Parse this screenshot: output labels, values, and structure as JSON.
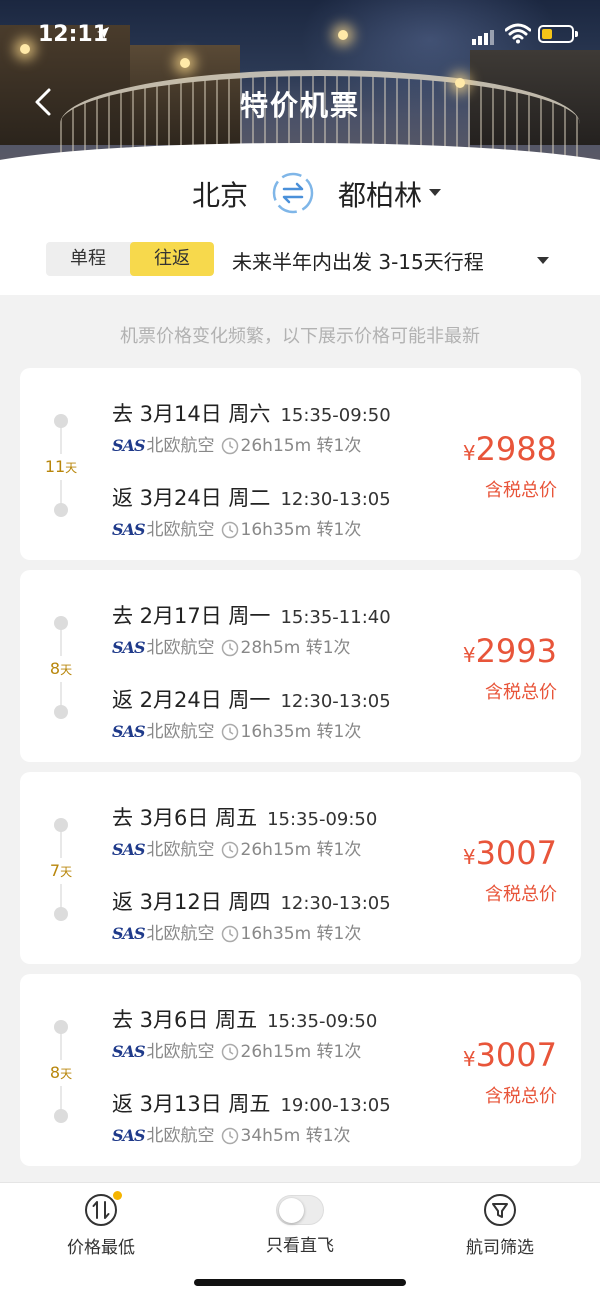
{
  "status_bar": {
    "time": "12:11"
  },
  "header": {
    "title": "特价机票"
  },
  "route": {
    "from": "北京",
    "to": "都柏林",
    "trip_types": [
      "单程",
      "往返"
    ],
    "selected_trip_type": "往返",
    "date_range": "未来半年内出发 3-15天行程"
  },
  "notice": "机票价格变化频繁，以下展示价格可能非最新",
  "flights": [
    {
      "days": "11",
      "days_unit": "天",
      "out": {
        "date": "去 3月14日 周六",
        "times": "15:35-09:50",
        "airline": "北欧航空",
        "duration": "26h15m",
        "stops": "转1次"
      },
      "ret": {
        "date": "返 3月24日 周二",
        "times": "12:30-13:05",
        "airline": "北欧航空",
        "duration": "16h35m",
        "stops": "转1次"
      },
      "currency": "¥",
      "price": "2988",
      "price_label": "含税总价"
    },
    {
      "days": "8",
      "days_unit": "天",
      "out": {
        "date": "去 2月17日 周一",
        "times": "15:35-11:40",
        "airline": "北欧航空",
        "duration": "28h5m",
        "stops": "转1次"
      },
      "ret": {
        "date": "返 2月24日 周一",
        "times": "12:30-13:05",
        "airline": "北欧航空",
        "duration": "16h35m",
        "stops": "转1次"
      },
      "currency": "¥",
      "price": "2993",
      "price_label": "含税总价"
    },
    {
      "days": "7",
      "days_unit": "天",
      "out": {
        "date": "去 3月6日 周五",
        "times": "15:35-09:50",
        "airline": "北欧航空",
        "duration": "26h15m",
        "stops": "转1次"
      },
      "ret": {
        "date": "返 3月12日 周四",
        "times": "12:30-13:05",
        "airline": "北欧航空",
        "duration": "16h35m",
        "stops": "转1次"
      },
      "currency": "¥",
      "price": "3007",
      "price_label": "含税总价"
    },
    {
      "days": "8",
      "days_unit": "天",
      "out": {
        "date": "去 3月6日 周五",
        "times": "15:35-09:50",
        "airline": "北欧航空",
        "duration": "26h15m",
        "stops": "转1次"
      },
      "ret": {
        "date": "返 3月13日 周五",
        "times": "19:00-13:05",
        "airline": "北欧航空",
        "duration": "34h5m",
        "stops": "转1次"
      },
      "currency": "¥",
      "price": "3007",
      "price_label": "含税总价"
    }
  ],
  "airline_logo_text": "SAS",
  "tabbar": {
    "sort_label": "价格最低",
    "direct_label": "只看直飞",
    "filter_label": "航司筛选"
  },
  "colors": {
    "price": "#e8553a",
    "accent_yellow": "#f7d94c",
    "days": "#b8860b"
  }
}
